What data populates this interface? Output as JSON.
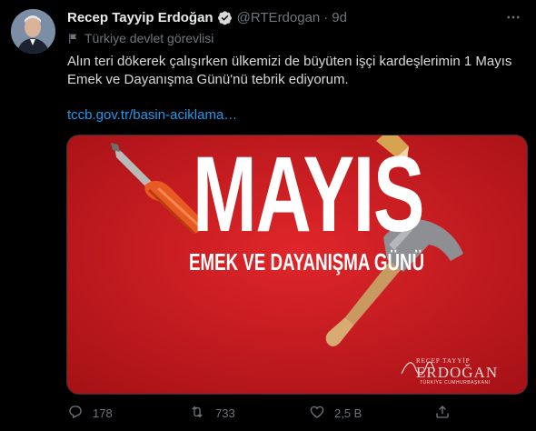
{
  "tweet": {
    "author_name": "Recep Tayyip Erdoğan",
    "handle": "@RTErdogan",
    "separator": "·",
    "time": "9d",
    "label": "Türkiye devlet görevlisi",
    "text": "Alın teri dökerek çalışırken ülkemizi de büyüten işçi kardeşlerimin 1 Mayıs Emek ve Dayanışma Günü'nü tebrik ediyorum.",
    "link": "tccb.gov.tr/basin-aciklama…"
  },
  "media": {
    "headline": "MAYIS",
    "subtitle": "EMEK VE DAYANIŞMA GÜNÜ",
    "signature_title": "RECEP TAYYİP",
    "signature_name": "ERDOĞAN",
    "signature_office": "TÜRKİYE CUMHURBAŞKANI",
    "background_color": "#c71a1f"
  },
  "actions": {
    "reply_count": "178",
    "retweet_count": "733",
    "like_count": "2,5 B"
  },
  "icons": [
    "verified-icon",
    "flag-icon",
    "more-icon",
    "reply-icon",
    "retweet-icon",
    "like-icon",
    "share-icon"
  ]
}
